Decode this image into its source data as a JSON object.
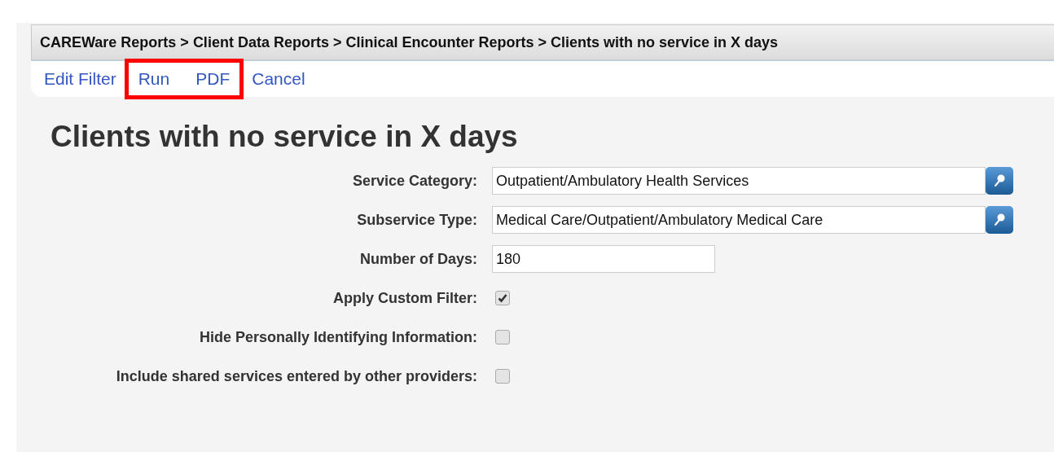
{
  "breadcrumb": "CAREWare Reports > Client Data Reports > Clinical Encounter Reports > Clients with no service in X days",
  "action_groups": [
    {
      "highlighted": false,
      "links": [
        "Edit Filter"
      ]
    },
    {
      "highlighted": true,
      "links": [
        "Run",
        "PDF"
      ]
    },
    {
      "highlighted": false,
      "links": [
        "Cancel"
      ]
    }
  ],
  "title": "Clients with no service in X days",
  "fields": [
    {
      "kind": "lookup",
      "label": "Service Category:",
      "value": "Outpatient/Ambulatory Health Services"
    },
    {
      "kind": "lookup",
      "label": "Subservice Type:",
      "value": "Medical Care/Outpatient/Ambulatory Medical Care"
    },
    {
      "kind": "text",
      "label": "Number of Days:",
      "value": "180"
    },
    {
      "kind": "checkbox",
      "label": "Apply Custom Filter:",
      "checked": true
    },
    {
      "kind": "checkbox",
      "label": "Hide Personally Identifying Information:",
      "checked": false
    },
    {
      "kind": "checkbox",
      "label": "Include shared services entered by other providers:",
      "checked": false
    }
  ]
}
